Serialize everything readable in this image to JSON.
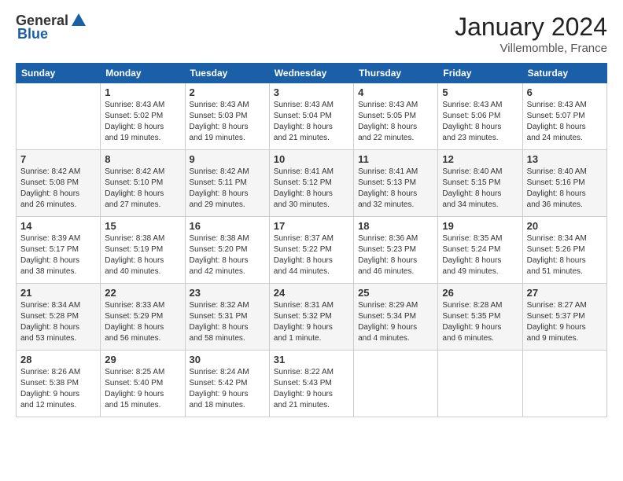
{
  "header": {
    "logo_general": "General",
    "logo_blue": "Blue",
    "month": "January 2024",
    "location": "Villemomble, France"
  },
  "weekdays": [
    "Sunday",
    "Monday",
    "Tuesday",
    "Wednesday",
    "Thursday",
    "Friday",
    "Saturday"
  ],
  "weeks": [
    [
      {
        "day": "",
        "info": ""
      },
      {
        "day": "1",
        "info": "Sunrise: 8:43 AM\nSunset: 5:02 PM\nDaylight: 8 hours\nand 19 minutes."
      },
      {
        "day": "2",
        "info": "Sunrise: 8:43 AM\nSunset: 5:03 PM\nDaylight: 8 hours\nand 19 minutes."
      },
      {
        "day": "3",
        "info": "Sunrise: 8:43 AM\nSunset: 5:04 PM\nDaylight: 8 hours\nand 21 minutes."
      },
      {
        "day": "4",
        "info": "Sunrise: 8:43 AM\nSunset: 5:05 PM\nDaylight: 8 hours\nand 22 minutes."
      },
      {
        "day": "5",
        "info": "Sunrise: 8:43 AM\nSunset: 5:06 PM\nDaylight: 8 hours\nand 23 minutes."
      },
      {
        "day": "6",
        "info": "Sunrise: 8:43 AM\nSunset: 5:07 PM\nDaylight: 8 hours\nand 24 minutes."
      }
    ],
    [
      {
        "day": "7",
        "info": "Sunrise: 8:42 AM\nSunset: 5:08 PM\nDaylight: 8 hours\nand 26 minutes."
      },
      {
        "day": "8",
        "info": "Sunrise: 8:42 AM\nSunset: 5:10 PM\nDaylight: 8 hours\nand 27 minutes."
      },
      {
        "day": "9",
        "info": "Sunrise: 8:42 AM\nSunset: 5:11 PM\nDaylight: 8 hours\nand 29 minutes."
      },
      {
        "day": "10",
        "info": "Sunrise: 8:41 AM\nSunset: 5:12 PM\nDaylight: 8 hours\nand 30 minutes."
      },
      {
        "day": "11",
        "info": "Sunrise: 8:41 AM\nSunset: 5:13 PM\nDaylight: 8 hours\nand 32 minutes."
      },
      {
        "day": "12",
        "info": "Sunrise: 8:40 AM\nSunset: 5:15 PM\nDaylight: 8 hours\nand 34 minutes."
      },
      {
        "day": "13",
        "info": "Sunrise: 8:40 AM\nSunset: 5:16 PM\nDaylight: 8 hours\nand 36 minutes."
      }
    ],
    [
      {
        "day": "14",
        "info": "Sunrise: 8:39 AM\nSunset: 5:17 PM\nDaylight: 8 hours\nand 38 minutes."
      },
      {
        "day": "15",
        "info": "Sunrise: 8:38 AM\nSunset: 5:19 PM\nDaylight: 8 hours\nand 40 minutes."
      },
      {
        "day": "16",
        "info": "Sunrise: 8:38 AM\nSunset: 5:20 PM\nDaylight: 8 hours\nand 42 minutes."
      },
      {
        "day": "17",
        "info": "Sunrise: 8:37 AM\nSunset: 5:22 PM\nDaylight: 8 hours\nand 44 minutes."
      },
      {
        "day": "18",
        "info": "Sunrise: 8:36 AM\nSunset: 5:23 PM\nDaylight: 8 hours\nand 46 minutes."
      },
      {
        "day": "19",
        "info": "Sunrise: 8:35 AM\nSunset: 5:24 PM\nDaylight: 8 hours\nand 49 minutes."
      },
      {
        "day": "20",
        "info": "Sunrise: 8:34 AM\nSunset: 5:26 PM\nDaylight: 8 hours\nand 51 minutes."
      }
    ],
    [
      {
        "day": "21",
        "info": "Sunrise: 8:34 AM\nSunset: 5:28 PM\nDaylight: 8 hours\nand 53 minutes."
      },
      {
        "day": "22",
        "info": "Sunrise: 8:33 AM\nSunset: 5:29 PM\nDaylight: 8 hours\nand 56 minutes."
      },
      {
        "day": "23",
        "info": "Sunrise: 8:32 AM\nSunset: 5:31 PM\nDaylight: 8 hours\nand 58 minutes."
      },
      {
        "day": "24",
        "info": "Sunrise: 8:31 AM\nSunset: 5:32 PM\nDaylight: 9 hours\nand 1 minute."
      },
      {
        "day": "25",
        "info": "Sunrise: 8:29 AM\nSunset: 5:34 PM\nDaylight: 9 hours\nand 4 minutes."
      },
      {
        "day": "26",
        "info": "Sunrise: 8:28 AM\nSunset: 5:35 PM\nDaylight: 9 hours\nand 6 minutes."
      },
      {
        "day": "27",
        "info": "Sunrise: 8:27 AM\nSunset: 5:37 PM\nDaylight: 9 hours\nand 9 minutes."
      }
    ],
    [
      {
        "day": "28",
        "info": "Sunrise: 8:26 AM\nSunset: 5:38 PM\nDaylight: 9 hours\nand 12 minutes."
      },
      {
        "day": "29",
        "info": "Sunrise: 8:25 AM\nSunset: 5:40 PM\nDaylight: 9 hours\nand 15 minutes."
      },
      {
        "day": "30",
        "info": "Sunrise: 8:24 AM\nSunset: 5:42 PM\nDaylight: 9 hours\nand 18 minutes."
      },
      {
        "day": "31",
        "info": "Sunrise: 8:22 AM\nSunset: 5:43 PM\nDaylight: 9 hours\nand 21 minutes."
      },
      {
        "day": "",
        "info": ""
      },
      {
        "day": "",
        "info": ""
      },
      {
        "day": "",
        "info": ""
      }
    ]
  ]
}
